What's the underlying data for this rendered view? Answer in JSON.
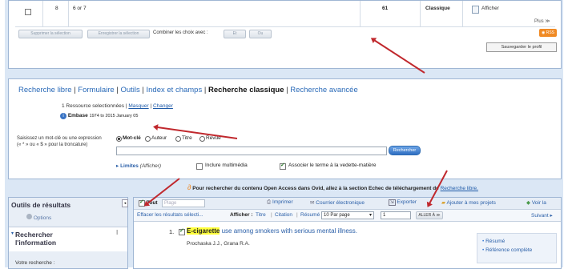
{
  "top_table": {
    "row": {
      "num": "8",
      "query": "6 or 7",
      "count": "61",
      "type": "Classique",
      "action": "Afficher"
    },
    "more": "Plus ≫",
    "delete_btn": "Supprimer la sélection",
    "save_btn": "Enregistrer la sélection",
    "combine_label": "Combiner les choix avec :",
    "combine_and": "Et",
    "combine_or": "Ou",
    "rss": "RSS",
    "save_profile": "Sauvegarder le profil"
  },
  "search": {
    "tabs": [
      {
        "label": "Recherche libre",
        "active": false
      },
      {
        "label": "Formulaire",
        "active": false
      },
      {
        "label": "Outils",
        "active": false
      },
      {
        "label": "Index et champs",
        "active": false
      },
      {
        "label": "Recherche classique",
        "active": true
      },
      {
        "label": "Recherche avancée",
        "active": false
      }
    ],
    "resources_text": "1 Ressource selectionnées |",
    "hide_link": "Masquer",
    "change_link": "Changer",
    "db_name": "Embase",
    "db_range": "1974 to 2015 January 05",
    "prompt": "Saisissez un mot-clé ou une expression (« * » ou « $ » pour la troncature)",
    "radios": [
      "Mot-clé",
      "Auteur",
      "Titre",
      "Revue"
    ],
    "search_btn": "Rechercher",
    "limits_label": "Limites",
    "limits_show": "(Afficher)",
    "include_multimedia": "Inclure multimédia",
    "associate_term": "Associer le terme à la vedette-matière"
  },
  "open_access": {
    "text": "Pour rechercher du contenu Open Access dans Ovid, allez à la section Echec de téléchargement de",
    "link": "Recherche libre."
  },
  "sidebar": {
    "tools_title": "Outils de résultats",
    "options": "Options",
    "research_title": "Rechercher l'information",
    "your_search": "Votre recherche :"
  },
  "results": {
    "toolbar": {
      "all": "Tout",
      "range_placeholder": "Plage",
      "print": "Imprimer",
      "email": "Courrier électronique",
      "export": "Exporter",
      "add_projects": "Ajouter à mes projets",
      "view": "Voir la"
    },
    "clear": "Effacer les résultats sélecti...",
    "display_label": "Afficher :",
    "display_title": "Titre",
    "display_citation": "Citation",
    "display_abstract": "Résumé",
    "per_page": "10 Par page",
    "page_value": "1",
    "goto": "ALLER À ≫",
    "next": "Suivant ▸",
    "item": {
      "number": "1.",
      "highlight": "E-cigarette",
      "title_rest": "use among smokers with serious mental illness.",
      "authors": "Prochaska J.J., Grana R.A.",
      "link_abstract": "Résumé",
      "link_full": "Référence complète"
    }
  }
}
